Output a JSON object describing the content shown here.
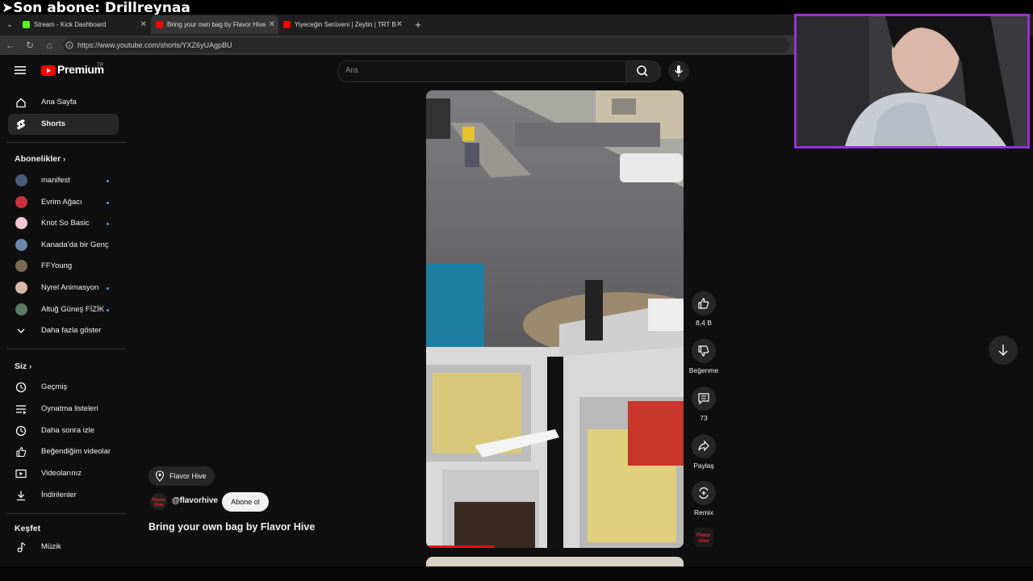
{
  "stream_overlay": {
    "text": "➤Son abone: Drillreynaa"
  },
  "browser": {
    "tabs": [
      {
        "label": "Stream - Kick Dashboard",
        "favicon_color": "#53fc18"
      },
      {
        "label": "Bring your own bag by Flavor Hive",
        "favicon_color": "#ff0000",
        "active": true
      },
      {
        "label": "Yiyeceğin Serüveni | Zeytin | TRT B",
        "favicon_color": "#ff0000"
      }
    ],
    "url": "https://www.youtube.com/shorts/YXZ6yUAgpBU"
  },
  "youtube": {
    "logo": {
      "text": "Premium",
      "region": "TR"
    },
    "search": {
      "placeholder": "Ara"
    },
    "sidebar": {
      "main": [
        {
          "label": "Ana Sayfa",
          "icon": "home-icon"
        },
        {
          "label": "Shorts",
          "icon": "shorts-icon",
          "selected": true
        }
      ],
      "subscriptions_header": "Abonelikler",
      "subscriptions": [
        {
          "label": "manifest",
          "new": true,
          "avatar_color": "#4a5b7a"
        },
        {
          "label": "Evrim Ağacı",
          "new": true,
          "avatar_color": "#c8333b"
        },
        {
          "label": "Knot So Basic",
          "new": true,
          "avatar_color": "#f2c9d0"
        },
        {
          "label": "Kanada'da bir Genç",
          "new": false,
          "avatar_color": "#6a86a8"
        },
        {
          "label": "FFYoung",
          "new": false,
          "avatar_color": "#7a6a52"
        },
        {
          "label": "Nyrel Animasyon",
          "new": true,
          "avatar_color": "#d9b9a6"
        },
        {
          "label": "Altuğ Güneş FİZİK",
          "new": true,
          "avatar_color": "#5c7a68"
        }
      ],
      "show_more": "Daha fazla göster",
      "you_header": "Siz",
      "you_items": [
        {
          "label": "Geçmiş",
          "icon": "history-icon"
        },
        {
          "label": "Oynatma listeleri",
          "icon": "playlists-icon"
        },
        {
          "label": "Daha sonra izle",
          "icon": "watch-later-icon"
        },
        {
          "label": "Beğendiğim videolar",
          "icon": "like-icon"
        },
        {
          "label": "Videolarınız",
          "icon": "your-videos-icon"
        },
        {
          "label": "İndirilenler",
          "icon": "download-icon"
        }
      ],
      "explore_header": "Keşfet",
      "explore_items": [
        {
          "label": "Müzik",
          "icon": "music-icon"
        }
      ]
    },
    "short": {
      "location": "Flavor Hive",
      "channel_handle": "@flavorhive",
      "subscribe_label": "Abone ol",
      "title": "Bring your own bag by Flavor Hive",
      "actions": {
        "like_count": "8,4 B",
        "dislike_label": "Beğenme",
        "comment_count": "73",
        "share_label": "Paylaş",
        "remix_label": "Remix"
      },
      "channel_logo_text": "Flavor Hive"
    }
  },
  "colors": {
    "accent_red": "#ff0000",
    "webcam_border": "#9b2fd8",
    "background": "#0f0f0f"
  }
}
